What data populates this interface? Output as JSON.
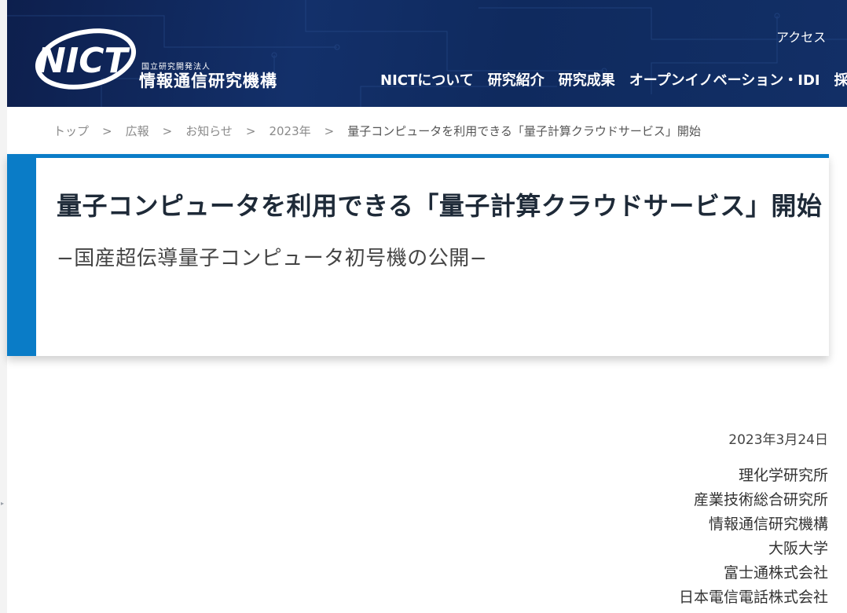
{
  "header": {
    "logo_text": "NICT",
    "org_type": "国立研究開発法人",
    "org_name": "情報通信研究機構",
    "utility_link": "アクセス",
    "nav": [
      "NICTについて",
      "研究紹介",
      "研究成果",
      "オープンイノベーション・IDI",
      "採用"
    ]
  },
  "breadcrumb": {
    "items": [
      "トップ",
      "広報",
      "お知らせ",
      "2023年"
    ],
    "separator": ">",
    "current": "量子コンピュータを利用できる「量子計算クラウドサービス」開始"
  },
  "article": {
    "title": "量子コンピュータを利用できる「量子計算クラウドサービス」開始",
    "subtitle": "−国産超伝導量子コンピュータ初号機の公開−",
    "date": "2023年3月24日",
    "organizations": [
      "理化学研究所",
      "産業技術総合研究所",
      "情報通信研究機構",
      "大阪大学",
      "富士通株式会社",
      "日本電信電話株式会社"
    ]
  },
  "colors": {
    "header_bg": "#13306a",
    "accent": "#0a7cc7",
    "title_text": "#1e2a38"
  }
}
